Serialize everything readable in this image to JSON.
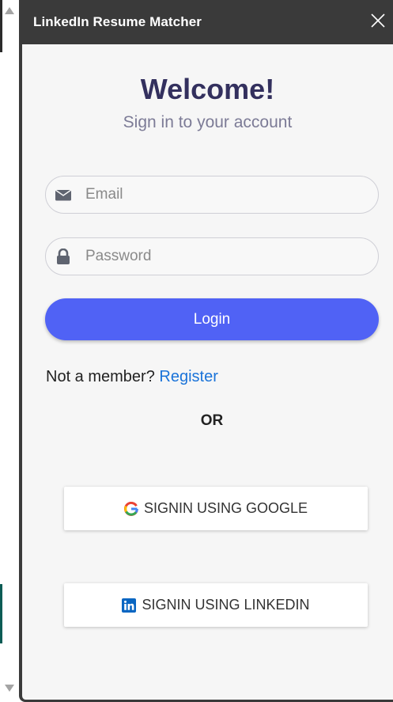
{
  "panel": {
    "title": "LinkedIn Resume Matcher"
  },
  "login_form": {
    "heading": "Welcome!",
    "subheading": "Sign in to your account",
    "email_placeholder": "Email",
    "password_placeholder": "Password",
    "login_label": "Login",
    "not_member_text": "Not a member?",
    "register_label": "Register",
    "or_label": "OR",
    "google_label": "SIGNIN USING GOOGLE",
    "linkedin_label": "SIGNIN USING LINKEDIN"
  },
  "icons": {
    "close": "close-icon",
    "email": "envelope-icon",
    "password": "lock-icon",
    "google": "google-logo-icon",
    "linkedin": "linkedin-logo-icon"
  },
  "colors": {
    "header_bg": "#3a3a3a",
    "heading": "#33305e",
    "primary_button": "#5062f5",
    "link": "#1a73d9",
    "linkedin_brand": "#0a66c2"
  }
}
